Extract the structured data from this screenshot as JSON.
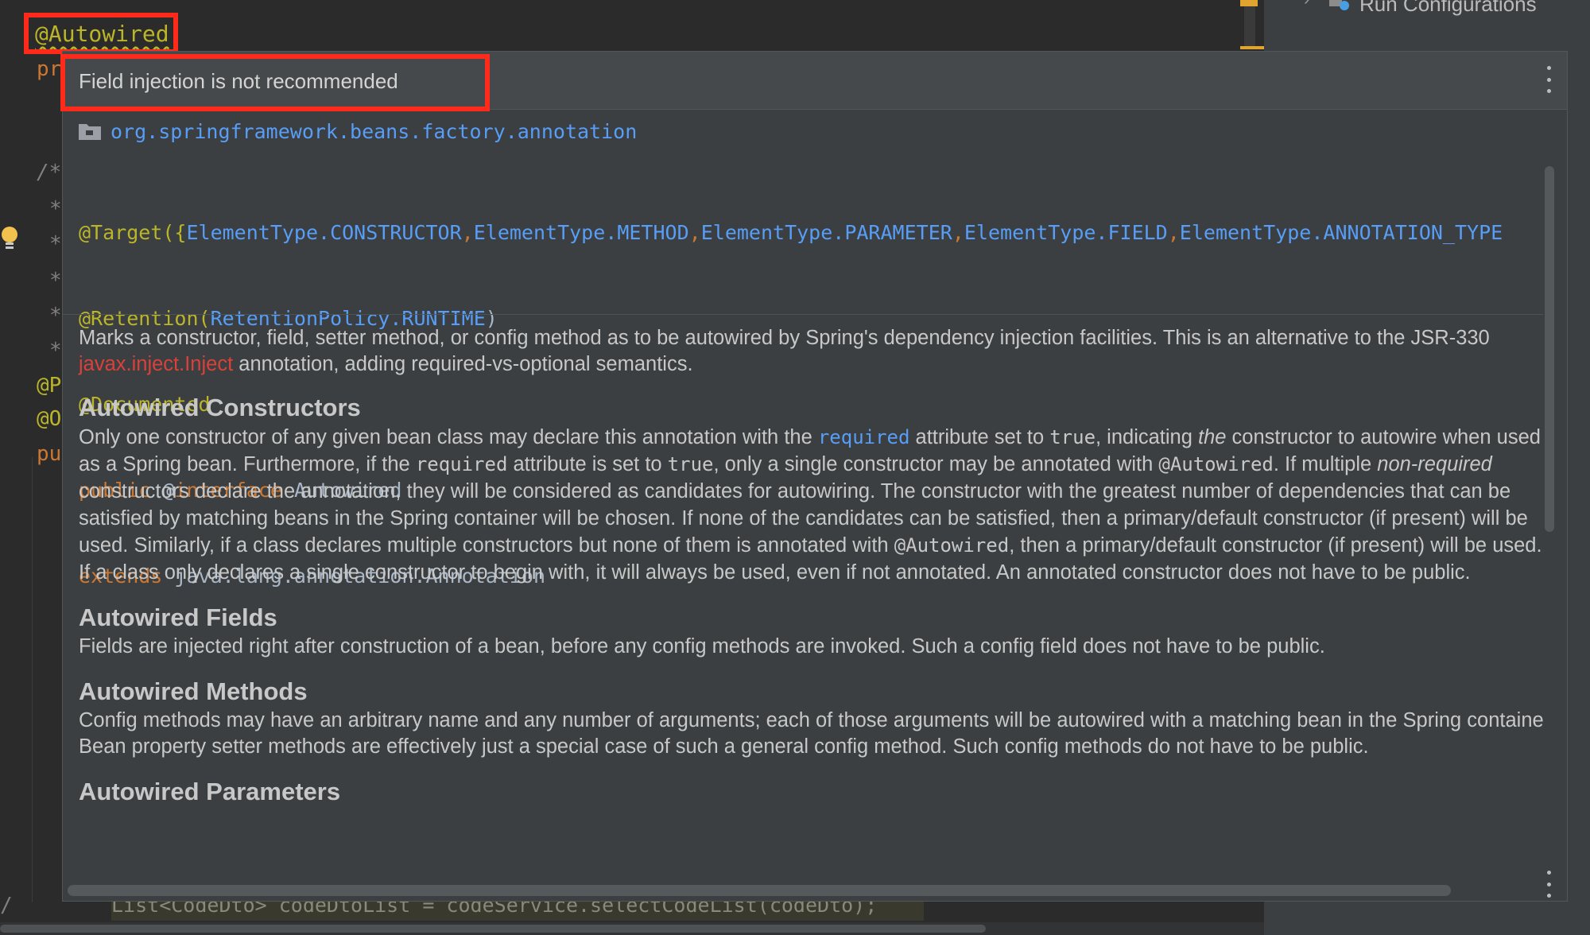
{
  "editor": {
    "annotation_top": "@Autowired",
    "fragments": {
      "line2": "pr",
      "c1": "/*",
      "c2": "*",
      "c3": "*",
      "c4": "*",
      "c5": "*",
      "c6": "*",
      "a1": "@P",
      "a2": "@O",
      "pu": "pu",
      "bottom_code": "List<CodeDto> codeDtoList = codeService.selectCodeList(codeDto);",
      "slash": "/"
    }
  },
  "right_panel": {
    "run_item": "Run Configurations"
  },
  "popup": {
    "title": "Field injection is not recommended",
    "package": "org.springframework.beans.factory.annotation",
    "target_prefix": "@Target({",
    "target_items": [
      "ElementType.CONSTRUCTOR",
      ",",
      "ElementType.METHOD",
      ",",
      "ElementType.PARAMETER",
      ",",
      "ElementType.FIELD",
      ",",
      "ElementType.ANNOTATION_TYPE"
    ],
    "retention_prefix": "@Retention(",
    "retention_value": "RetentionPolicy.RUNTIME",
    "retention_suffix": ")",
    "documented": "@Documented",
    "decl_public": "public",
    "decl_at": "@",
    "decl_interface": "interface",
    "decl_name": "Autowired",
    "decl_extends": "extends",
    "decl_super": "java.lang.annotation.Annotation",
    "intro_1": "Marks a constructor, field, setter method, or config method as to be autowired by Spring's dependency injection facilities. This is an alternative to the JSR-330 ",
    "intro_link": "javax.inject.Inject",
    "intro_2": " annotation, adding required-vs-optional semantics.",
    "h_constructors": "Autowired Constructors",
    "c_p1": "Only one constructor of any given bean class may declare this annotation with the ",
    "c_link_required": "required",
    "c_p2": " attribute set to ",
    "c_true1": "true",
    "c_p3": ", indicating ",
    "c_the": "the",
    "c_p4": " constructor to autowire when used as a Spring bean. Furthermore, if the ",
    "c_required2": "required",
    "c_p5": " attribute is set to ",
    "c_true2": "true",
    "c_p6": ", only a single constructor may be annotated with ",
    "c_autowired1": "@Autowired",
    "c_p7": ". If multiple ",
    "c_nonrequired": "non-required",
    "c_p8": " constructors declare the annotation, they will be considered as candidates for autowiring. The constructor with the greatest number of dependencies that can be satisfied by matching beans in the Spring container will be chosen. If none of the candidates can be satisfied, then a primary/default constructor (if present) will be used. Similarly, if a class declares multiple constructors but none of them is annotated with ",
    "c_autowired2": "@Autowired",
    "c_p9": ", then a primary/default constructor (if present) will be used. If a class only declares a single constructor to begin with, it will always be used, even if not annotated. An annotated constructor does not have to be public.",
    "h_fields": "Autowired Fields",
    "fields_text": "Fields are injected right after construction of a bean, before any config methods are invoked. Such a config field does not have to be public.",
    "h_methods": "Autowired Methods",
    "methods_text": "Config methods may have an arbitrary name and any number of arguments; each of those arguments will be autowired with a matching bean in the Spring container. Bean property setter methods are effectively just a special case of such a general config method. Such config methods do not have to be public.",
    "h_parameters": "Autowired Parameters"
  },
  "colors": {
    "highlight_box": "#ff2a1a",
    "link_blue": "#589df6",
    "keyword_orange": "#cc7832",
    "annotation_yellow": "#bbb529",
    "link_red": "#d9413a"
  },
  "icons": [
    "folder-icon",
    "more-options-icon",
    "lightbulb-icon",
    "run-configurations-icon",
    "chevron-right-icon"
  ]
}
